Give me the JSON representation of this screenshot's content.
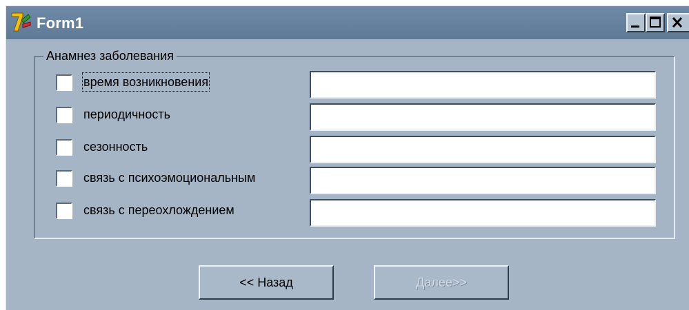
{
  "window": {
    "title": "Form1",
    "controls": {
      "minimize": "minimize",
      "maximize": "maximize",
      "close": "close"
    }
  },
  "group": {
    "label": "Анамнез заболевания",
    "rows": [
      {
        "label": "время возникновения",
        "checked": false,
        "value": "",
        "focused": true
      },
      {
        "label": "периодичность",
        "checked": false,
        "value": ""
      },
      {
        "label": "сезонность",
        "checked": false,
        "value": ""
      },
      {
        "label": "связь с психоэмоциональным",
        "checked": false,
        "value": ""
      },
      {
        "label": "связь с переохлождением",
        "checked": false,
        "value": ""
      }
    ]
  },
  "buttons": {
    "back": "<< Назад",
    "next": "Далее>>"
  },
  "colors": {
    "form_background": "#a5b5c6",
    "titlebar": "#6f8aa6",
    "disabled_text": "#d3dce5"
  }
}
